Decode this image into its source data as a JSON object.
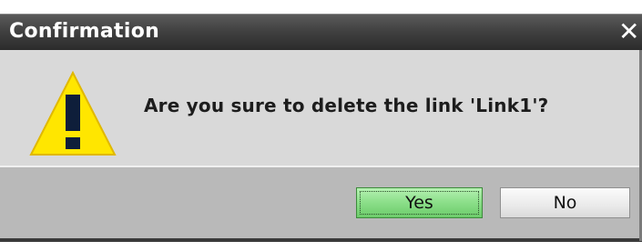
{
  "dialog": {
    "title": "Confirmation",
    "close_icon": "close-icon",
    "message": "Are you sure to delete the link 'Link1'?",
    "warning_icon": "warning-icon",
    "buttons": {
      "yes_label": "Yes",
      "no_label": "No"
    }
  },
  "colors": {
    "titlebar": "#3f3f3f",
    "body": "#d9d9d9",
    "footer": "#b9b9b9",
    "yes_button": "#8ee08c",
    "warning_yellow": "#ffe600"
  }
}
